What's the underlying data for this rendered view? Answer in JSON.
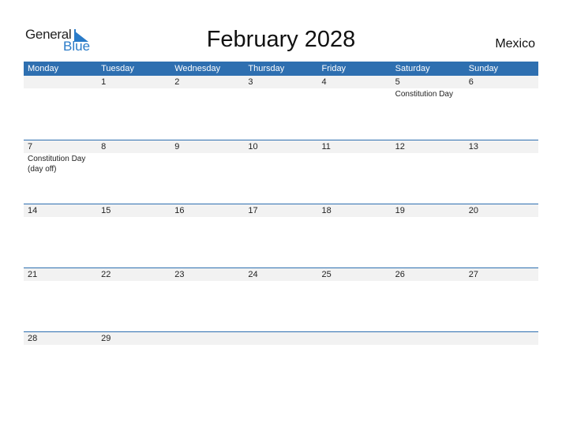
{
  "logo": {
    "word1": "General",
    "word2": "Blue"
  },
  "title": "February 2028",
  "country": "Mexico",
  "weekdays": [
    "Monday",
    "Tuesday",
    "Wednesday",
    "Thursday",
    "Friday",
    "Saturday",
    "Sunday"
  ],
  "weeks": [
    {
      "days": [
        "",
        "1",
        "2",
        "3",
        "4",
        "5",
        "6"
      ],
      "events": [
        "",
        "",
        "",
        "",
        "",
        "Constitution Day",
        ""
      ]
    },
    {
      "days": [
        "7",
        "8",
        "9",
        "10",
        "11",
        "12",
        "13"
      ],
      "events": [
        "Constitution Day\n(day off)",
        "",
        "",
        "",
        "",
        "",
        ""
      ]
    },
    {
      "days": [
        "14",
        "15",
        "16",
        "17",
        "18",
        "19",
        "20"
      ],
      "events": [
        "",
        "",
        "",
        "",
        "",
        "",
        ""
      ]
    },
    {
      "days": [
        "21",
        "22",
        "23",
        "24",
        "25",
        "26",
        "27"
      ],
      "events": [
        "",
        "",
        "",
        "",
        "",
        "",
        ""
      ]
    },
    {
      "days": [
        "28",
        "29",
        "",
        "",
        "",
        "",
        ""
      ],
      "events": [
        "",
        "",
        "",
        "",
        "",
        "",
        ""
      ]
    }
  ],
  "colors": {
    "header": "#2e6fb0",
    "brand_blue": "#2a7bc8",
    "date_strip": "#f2f2f2"
  }
}
